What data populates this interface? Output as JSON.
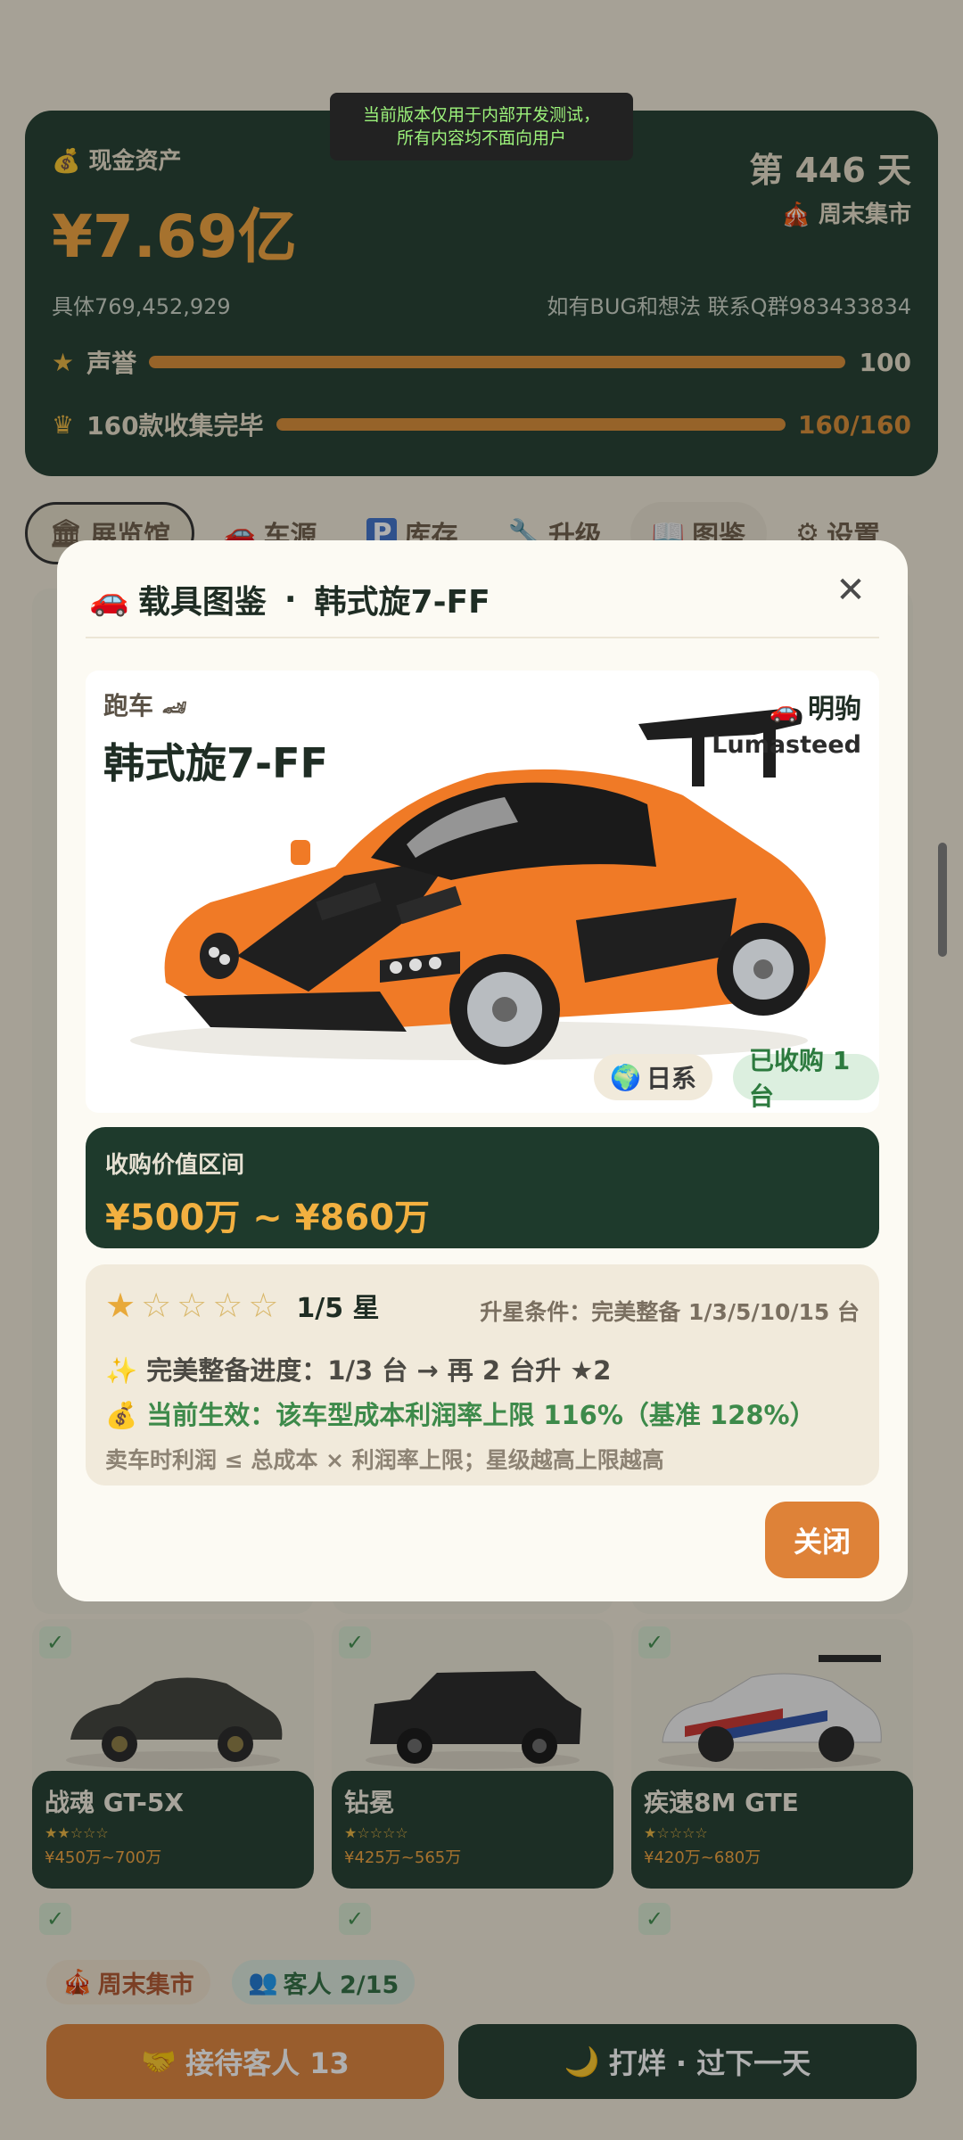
{
  "dev_banner": {
    "line1": "当前版本仅用于内部开发测试，",
    "line2": "所有内容均不面向用户"
  },
  "header": {
    "cash_label": "现金资产",
    "cash_value": "¥7.69亿",
    "day": "第 446 天",
    "market": "周末集市",
    "exact": "具体769,452,929",
    "qq": "如有BUG和想法 联系Q群983433834",
    "fame_label": "声誉",
    "fame_value": "100",
    "fame_progress": 1.0,
    "collection_label": "160款收集完毕",
    "collection_value": "160/160",
    "collection_progress": 1.0
  },
  "tabs": [
    {
      "label": "展览馆",
      "icon": "museum-icon"
    },
    {
      "label": "车源",
      "icon": "car-icon"
    },
    {
      "label": "库存",
      "icon": "parking-icon"
    },
    {
      "label": "升级",
      "icon": "wrench-icon"
    },
    {
      "label": "图鉴",
      "icon": "book-icon"
    },
    {
      "label": "设置",
      "icon": "gear-icon"
    }
  ],
  "grid_cars": [
    {
      "name": "战魂 GT-5X",
      "stars": "★★☆☆☆",
      "price": "¥450万~700万"
    },
    {
      "name": "钻冕",
      "stars": "★☆☆☆☆",
      "price": "¥425万~565万"
    },
    {
      "name": "疾速8M GTE",
      "stars": "★☆☆☆☆",
      "price": "¥420万~680万"
    }
  ],
  "bottom": {
    "market_chip": "周末集市",
    "guest_chip": "客人 2/15",
    "serve_button": "接待客人 13",
    "end_day_button": "打烊 · 过下一天"
  },
  "modal": {
    "title": "载具图鉴",
    "dot": "·",
    "car_title": "韩式旋7-FF",
    "close_icon": "✕",
    "type": "跑车",
    "name": "韩式旋7-FF",
    "brand": "明驹",
    "brand_en": "Lumasteed",
    "origin_pill": "日系",
    "owned_pill": "已收购 1 台",
    "price_label": "收购价值区间",
    "price_value": "¥500万 ~ ¥860万",
    "stars_on": 1,
    "stars_total": 5,
    "stars_text": "1/5 星",
    "upgrade_cond": "升星条件：完美整备 1/3/5/10/15 台",
    "progress_line": "完美整备进度：1/3 台 → 再 2 台升 ★2",
    "effect_line": "当前生效：该车型成本利润率上限 116%（基准 128%）",
    "note_line": "卖车时利润 ≤ 总成本 × 利润率上限；星级越高上限越高",
    "close_button": "关闭"
  },
  "colors": {
    "dark_green": "#1e3a2c",
    "orange": "#de8238",
    "gold": "#f2a23a",
    "cream": "#fcfaf3"
  }
}
